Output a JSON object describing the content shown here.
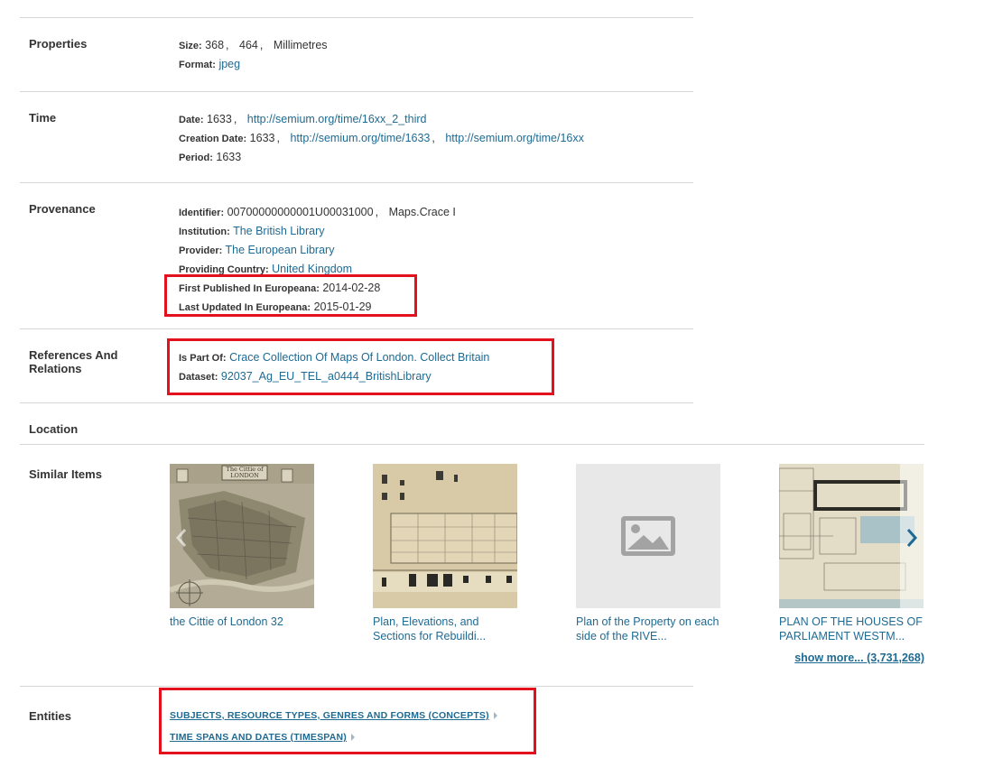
{
  "properties": {
    "label": "Properties",
    "size_key": "Size:",
    "size_w": "368",
    "size_h": "464",
    "size_unit": "Millimetres",
    "format_key": "Format:",
    "format_val": "jpeg"
  },
  "time": {
    "label": "Time",
    "date_key": "Date:",
    "date_val": "1633",
    "date_link": "http://semium.org/time/16xx_2_third",
    "creation_key": "Creation Date:",
    "creation_val": "1633",
    "creation_link1": "http://semium.org/time/1633",
    "creation_link2": "http://semium.org/time/16xx",
    "period_key": "Period:",
    "period_val": "1633"
  },
  "provenance": {
    "label": "Provenance",
    "identifier_key": "Identifier:",
    "identifier_val1": "00700000000001U00031000",
    "identifier_val2": "Maps.Crace I",
    "institution_key": "Institution:",
    "institution_val": "The British Library",
    "provider_key": "Provider:",
    "provider_val": "The European Library",
    "country_key": "Providing Country:",
    "country_val": "United Kingdom",
    "first_pub_key": "First Published In Europeana:",
    "first_pub_val": "2014-02-28",
    "last_upd_key": "Last Updated In Europeana:",
    "last_upd_val": "2015-01-29"
  },
  "references": {
    "label_line1": "References And",
    "label_line2": "Relations",
    "partof_key": "Is Part Of:",
    "partof_val": "Crace Collection Of Maps Of London. Collect Britain",
    "dataset_key": "Dataset:",
    "dataset_val": "92037_Ag_EU_TEL_a0444_BritishLibrary"
  },
  "location": {
    "label": "Location"
  },
  "similar": {
    "label": "Similar Items",
    "items": [
      {
        "title": "the Cittie of London 32",
        "thumb_text": "The Cittie of LONDON"
      },
      {
        "title": "Plan, Elevations, and Sections for Rebuildi..."
      },
      {
        "title": "Plan of the Property on each side of the RIVE..."
      },
      {
        "title": "PLAN OF THE HOUSES OF PARLIAMENT WESTM..."
      }
    ],
    "show_more": "show more... (3,731,268)"
  },
  "entities": {
    "label": "Entities",
    "links": [
      "SUBJECTS, RESOURCE TYPES, GENRES AND FORMS (CONCEPTS)",
      "TIME SPANS AND DATES (TIMESPAN)"
    ]
  },
  "colors": {
    "link": "#1f6a92",
    "highlight": "#e3111d",
    "divider": "#d6d6d6"
  }
}
